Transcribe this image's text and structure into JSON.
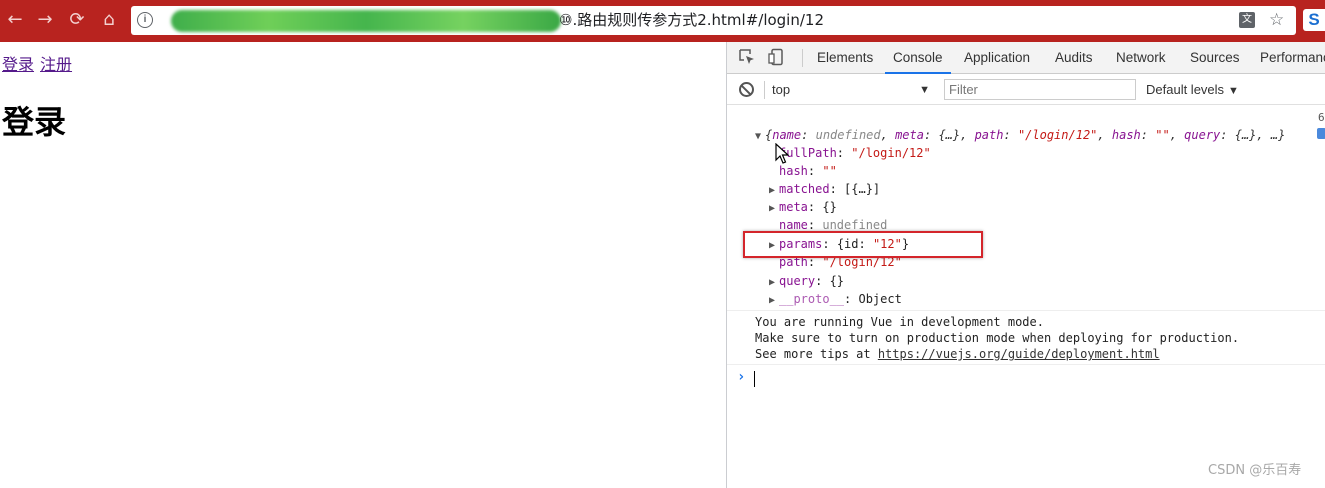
{
  "browser": {
    "url_visible": "⑩.路由规则传参方式2.html#/login/12",
    "nav": {
      "back": "←",
      "forward": "→",
      "reload": "⟳",
      "home": "⌂"
    },
    "icons": [
      "info-icon",
      "translate-icon",
      "star-icon",
      "extension-icon"
    ],
    "translate_glyph": "文",
    "star_glyph": "☆",
    "extension_glyph": "S"
  },
  "page": {
    "links": [
      "登录",
      "注册"
    ],
    "title": "登录"
  },
  "devtools": {
    "tabs": [
      "Elements",
      "Console",
      "Application",
      "Audits",
      "Network",
      "Sources",
      "Performance"
    ],
    "active_tab": "Console",
    "context": "top",
    "filter_placeholder": "Filter",
    "levels": "Default levels",
    "console": {
      "summary": {
        "open": "{",
        "name_key": "name",
        "name_val": "undefined",
        "meta_key": "meta",
        "meta_val": "{…}",
        "path_key": "path",
        "path_val": "\"/login/12\"",
        "hash_key": "hash",
        "hash_val": "\"\"",
        "query_key": "query",
        "query_val": "{…}",
        "tail": "…}"
      },
      "props": [
        {
          "key": "fullPath",
          "value": "\"/login/12\"",
          "type": "string",
          "expandable": false
        },
        {
          "key": "hash",
          "value": "\"\"",
          "type": "string",
          "expandable": false
        },
        {
          "key": "matched",
          "value": "[{…}]",
          "type": "object",
          "expandable": true
        },
        {
          "key": "meta",
          "value": "{}",
          "type": "object",
          "expandable": true
        },
        {
          "key": "name",
          "value": "undefined",
          "type": "undefined",
          "expandable": false
        },
        {
          "key": "params",
          "value_prefix": "{id: ",
          "value_str": "\"12\"",
          "value_suffix": "}",
          "type": "params",
          "expandable": true
        },
        {
          "key": "path",
          "value": "\"/login/12\"",
          "type": "string",
          "expandable": false
        },
        {
          "key": "query",
          "value": "{}",
          "type": "object",
          "expandable": true
        },
        {
          "key": "__proto__",
          "value": "Object",
          "type": "proto",
          "expandable": true
        }
      ],
      "messages": [
        "You are running Vue in development mode.",
        "Make sure to turn on production mode when deploying for production."
      ],
      "tips_prefix": "See more tips at ",
      "tips_link": "https://vuejs.org/guide/deployment.html",
      "prompt": "›",
      "side_number": "6"
    }
  },
  "watermark": "CSDN @乐百寿",
  "colors": {
    "toolbar": "#b8231f",
    "link": "#551a8b",
    "highlight": "#d4252b",
    "accent": "#1a73e8",
    "key": "#881391",
    "string": "#c41a16"
  }
}
